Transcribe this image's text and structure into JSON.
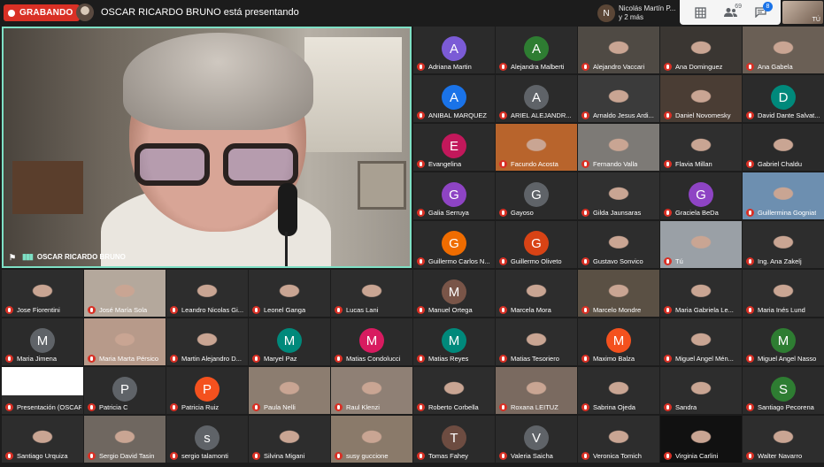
{
  "topbar": {
    "recording_label": "GRABANDO",
    "presenter_text": "OSCAR RICARDO BRUNO está presentando",
    "raised_initial": "N",
    "raised_text_line1": "Nicolás Martín P...",
    "raised_text_line2": "y 2 más",
    "participants_count": "69",
    "chat_badge": "8",
    "self_label": "TÚ"
  },
  "main_speaker": {
    "name": "OSCAR RICARDO BRUNO"
  },
  "tiles": [
    {
      "name": "Adriana Martin",
      "initial": "A",
      "color": "#7b5bd6"
    },
    {
      "name": "Alejandra Malberti",
      "initial": "A",
      "color": "#2e7d32"
    },
    {
      "name": "Alejandro Vaccari",
      "video": "#4f4a44"
    },
    {
      "name": "Ana Dominguez",
      "video": "#3a3632"
    },
    {
      "name": "Ana Gabela",
      "video": "#6a5f55"
    },
    {
      "name": "ANIBAL MARQUEZ",
      "initial": "A",
      "color": "#1a73e8"
    },
    {
      "name": "ARIEL ALEJANDR...",
      "initial": "A",
      "color": "#5f6368"
    },
    {
      "name": "Arnaldo Jesus Ardi...",
      "video": "#3b3b3b"
    },
    {
      "name": "Daniel Novomesky",
      "video": "#4a3d34"
    },
    {
      "name": "David Dante Salvat...",
      "initial": "D",
      "color": "#00897b"
    },
    {
      "name": "Evangelina",
      "initial": "E",
      "color": "#c2185b"
    },
    {
      "name": "Facundo Acosta",
      "video": "#b8642c"
    },
    {
      "name": "Fernando Valla",
      "video": "#7d7a76"
    },
    {
      "name": "Flavia Millan",
      "video": "#2f2f2f"
    },
    {
      "name": "Gabriel Chaldu",
      "video": "#2a2a2a"
    },
    {
      "name": "Galia Serruya",
      "initial": "G",
      "color": "#8e44c4"
    },
    {
      "name": "Gayoso",
      "initial": "G",
      "color": "#5f6368"
    },
    {
      "name": "Gilda Jaunsaras",
      "video": "#303030"
    },
    {
      "name": "Graciela BeDa",
      "initial": "G",
      "color": "#8e44c4"
    },
    {
      "name": "Guillermina Gogniat",
      "video": "#6d8fb0"
    },
    {
      "name": "Guillermo Carlos N...",
      "initial": "G",
      "color": "#ef6c00"
    },
    {
      "name": "Guillermo Oliveto",
      "initial": "G",
      "color": "#d84315"
    },
    {
      "name": "Gustavo Sonvico",
      "video": "#2d2d2d"
    },
    {
      "name": "Tú",
      "video": "#9aa0a6"
    },
    {
      "name": "Ing. Ana Zakelj",
      "video": "#2d2d2d"
    },
    {
      "name": "Jose Fiorentini",
      "video": "#2d2d2d"
    },
    {
      "name": "José María Sola",
      "video": "#b4a89c"
    },
    {
      "name": "Leandro Nicolas Gi...",
      "video": "#2d2d2d"
    },
    {
      "name": "Leonel Ganga",
      "video": "#2d2d2d"
    },
    {
      "name": "Lucas Lani",
      "video": "#2d2d2d"
    },
    {
      "name": "Manuel Ortega",
      "initial": "M",
      "color": "#795548"
    },
    {
      "name": "Marcela Mora",
      "video": "#2d2d2d"
    },
    {
      "name": "Marcelo Mondre",
      "video": "#5a5044"
    },
    {
      "name": "Maria Gabriela Le...",
      "video": "#2d2d2d"
    },
    {
      "name": "Maria Inés Lund",
      "video": "#2d2d2d"
    },
    {
      "name": "Maria Jimena",
      "initial": "M",
      "color": "#5f6368"
    },
    {
      "name": "Maria Marta Pérsico",
      "video": "#b79a8a"
    },
    {
      "name": "Martin Alejandro D...",
      "video": "#2d2d2d"
    },
    {
      "name": "Maryel Paz",
      "initial": "M",
      "color": "#00897b"
    },
    {
      "name": "Matias Condolucci",
      "initial": "M",
      "color": "#d81b60"
    },
    {
      "name": "Matias Reyes",
      "initial": "M",
      "color": "#00897b"
    },
    {
      "name": "Matias Tesoriero",
      "video": "#2d2d2d"
    },
    {
      "name": "Maximo Balza",
      "initial": "M",
      "color": "#f4511e"
    },
    {
      "name": "Miguel Angel Mén...",
      "video": "#2d2d2d"
    },
    {
      "name": "Miguel Angel Nasso",
      "initial": "M",
      "color": "#2e7d32"
    },
    {
      "name": "Presentación (OSCAR RICA...",
      "video": "#2d2d2d",
      "presentation": true
    },
    {
      "name": "Patricia C",
      "initial": "P",
      "color": "#5f6368"
    },
    {
      "name": "Patricia Ruiz",
      "initial": "P",
      "color": "#f4511e"
    },
    {
      "name": "Paula Nelli",
      "video": "#8c7d70"
    },
    {
      "name": "Raul Klenzi",
      "video": "#8f8075"
    },
    {
      "name": "Roberto Corbella",
      "video": "#2d2d2d"
    },
    {
      "name": "Roxana LEITUZ",
      "video": "#7a6a60"
    },
    {
      "name": "Sabrina Ojeda",
      "video": "#2d2d2d"
    },
    {
      "name": "Sandra",
      "video": "#2d2d2d"
    },
    {
      "name": "Santiago Pecorena",
      "initial": "S",
      "color": "#2e7d32"
    },
    {
      "name": "Santiago Urquiza",
      "video": "#2d2d2d"
    },
    {
      "name": "Sergio David Tasin",
      "video": "#6f6760"
    },
    {
      "name": "sergio talamonti",
      "initial": "s",
      "color": "#5f6368"
    },
    {
      "name": "Silvina Migani",
      "video": "#2d2d2d"
    },
    {
      "name": "susy guccione",
      "video": "#8a7a6a"
    },
    {
      "name": "Tomas Fahey",
      "initial": "T",
      "color": "#6d4c41"
    },
    {
      "name": "Valeria Saicha",
      "initial": "V",
      "color": "#5f6368"
    },
    {
      "name": "Veronica Tomich",
      "video": "#2d2d2d"
    },
    {
      "name": "Virginia Carlini",
      "video": "#111111"
    },
    {
      "name": "Walter Navarro",
      "video": "#2d2d2d"
    }
  ]
}
